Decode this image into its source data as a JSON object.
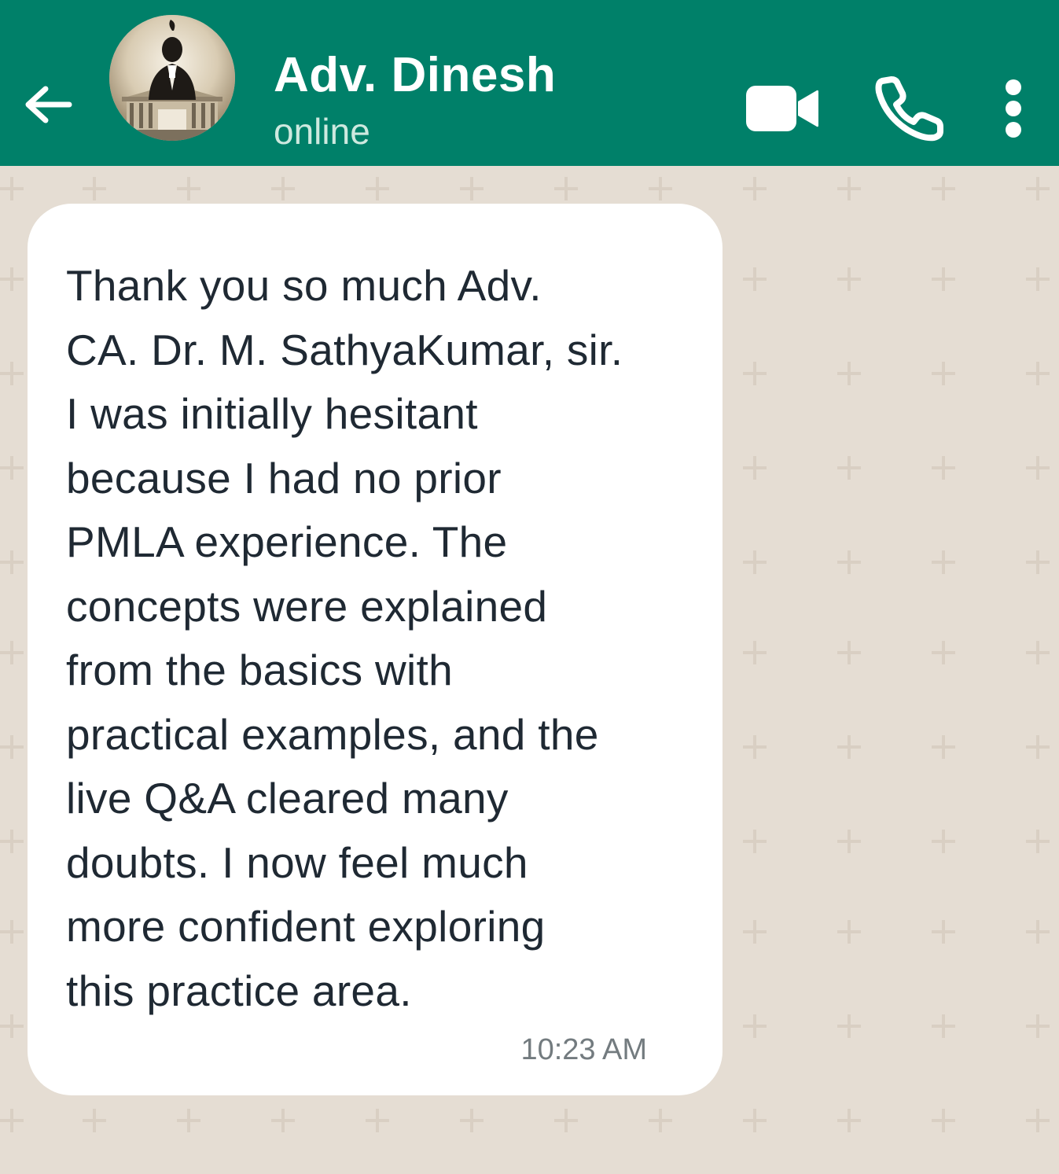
{
  "header": {
    "contact_name": "Adv. Dinesh",
    "status": "online",
    "background_color": "#008069",
    "icons": {
      "back": "arrow-left-icon",
      "avatar": "profile-photo",
      "video": "video-camera-icon",
      "call": "phone-icon",
      "menu": "more-vertical-icon"
    }
  },
  "chat": {
    "wallpaper_color": "#e5ddd3",
    "messages": [
      {
        "direction": "incoming",
        "text": "Thank you so much Adv.\nCA. Dr. M. SathyaKumar, sir.\nI was initially hesitant\nbecause I had no prior\nPMLA experience. The\nconcepts were explained\nfrom the basics with\npractical examples, and the\nlive Q&A cleared many\ndoubts. I now feel much\nmore confident exploring\nthis practice area.",
        "time": "10:23 AM"
      }
    ]
  }
}
